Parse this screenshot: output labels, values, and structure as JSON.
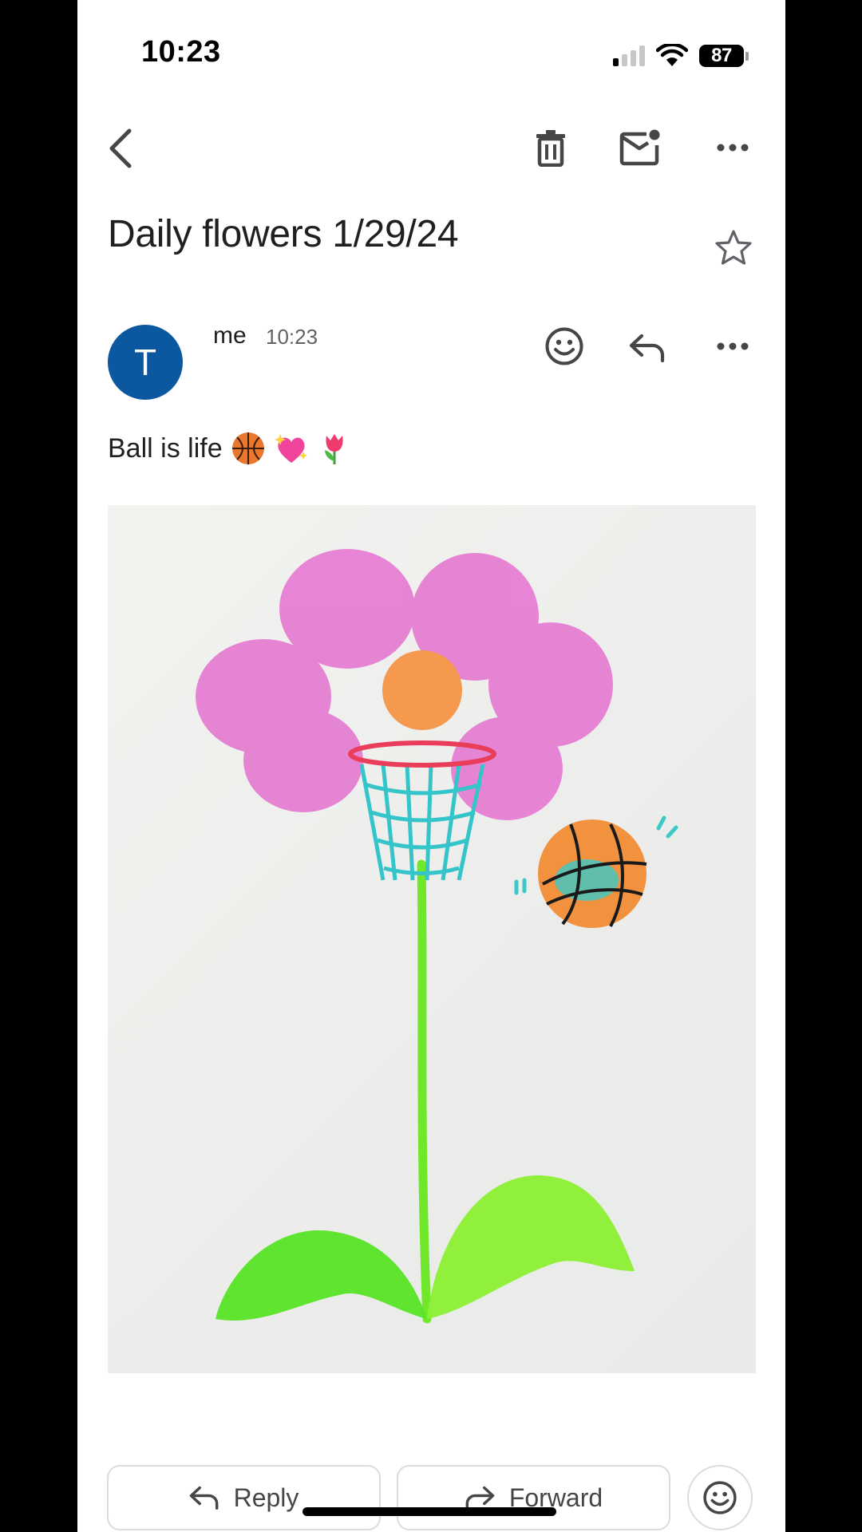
{
  "status_bar": {
    "time": "10:23",
    "battery": "87",
    "signal_bars_active": 1,
    "signal_bars_total": 4
  },
  "toolbar": {
    "icons": [
      "back-arrow-icon",
      "trash-icon",
      "mark-unread-icon",
      "more-icon"
    ]
  },
  "message": {
    "subject": "Daily flowers 1/29/24",
    "sender_initial": "T",
    "sender": "me",
    "time": "10:23",
    "body": "Ball is life",
    "body_emoji": [
      "basketball-emoji",
      "sparkling-heart-emoji",
      "tulip-emoji"
    ]
  },
  "actions": {
    "reply_label": "Reply",
    "forward_label": "Forward"
  },
  "colors": {
    "avatar": "#0b57a0",
    "petal": "#e879cf",
    "stem": "#5fe82a",
    "net": "#3cc9c9",
    "ball": "#f29a4a"
  }
}
